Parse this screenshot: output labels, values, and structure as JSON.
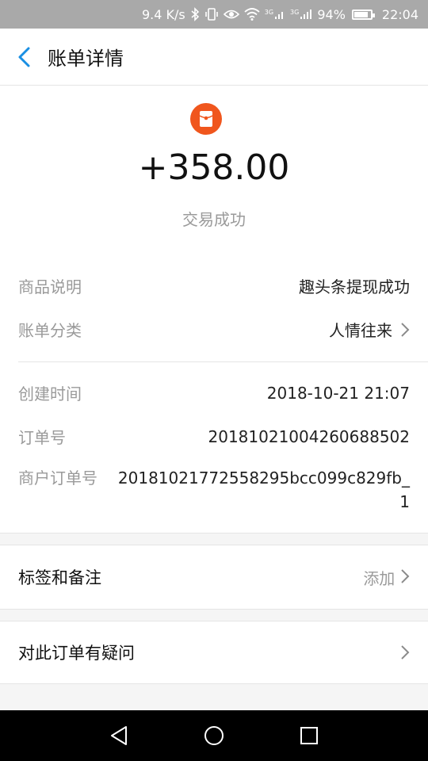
{
  "status_bar": {
    "speed": "9.4 K/s",
    "network1": "3G",
    "network2": "3G",
    "battery": "94%",
    "time": "22:04"
  },
  "header": {
    "title": "账单详情"
  },
  "summary": {
    "amount": "+358.00",
    "status": "交易成功",
    "icon": "red-packet-icon",
    "accent_color": "#f0561d"
  },
  "details": {
    "group1": [
      {
        "label": "商品说明",
        "value": "趣头条提现成功"
      },
      {
        "label": "账单分类",
        "value": "人情往来"
      }
    ],
    "group2": [
      {
        "label": "创建时间",
        "value": "2018-10-21 21:07"
      },
      {
        "label": "订单号",
        "value": "20181021004260688502"
      },
      {
        "label": "商户订单号",
        "value": "20181021772558295bcc099c829fb_1"
      }
    ]
  },
  "actions": {
    "tags": {
      "label": "标签和备注",
      "hint": "添加"
    },
    "question": {
      "label": "对此订单有疑问"
    }
  }
}
